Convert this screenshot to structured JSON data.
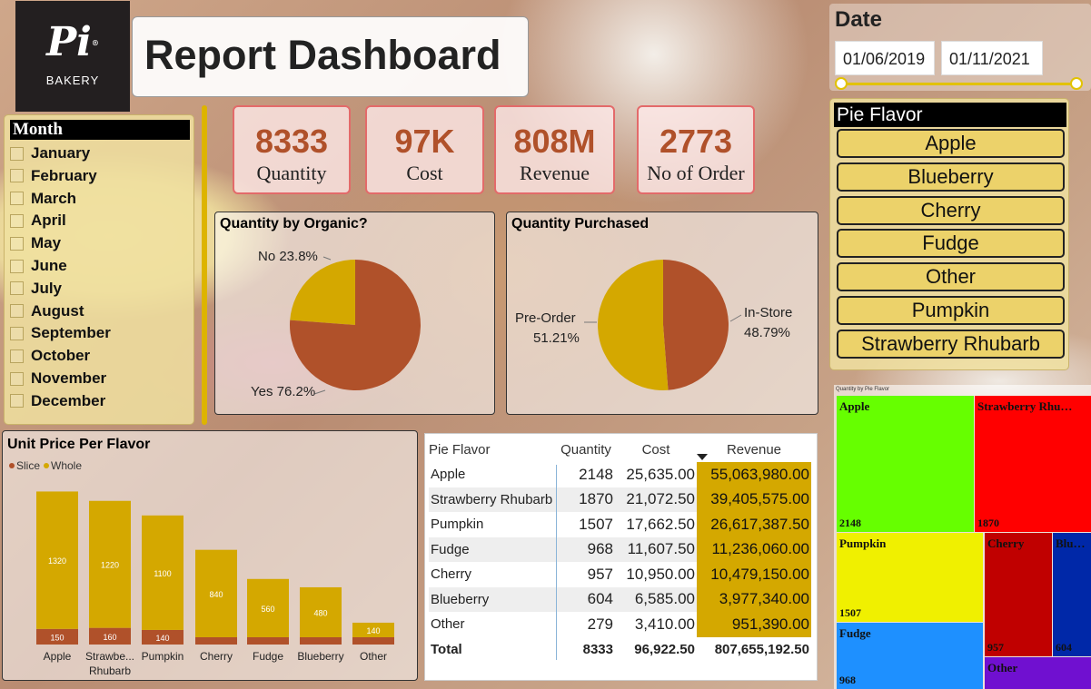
{
  "logo": {
    "mark": "Pi",
    "reg": "®",
    "sub": "BAKERY"
  },
  "title": "Report Dashboard",
  "month_slicer": {
    "title": "Month",
    "items": [
      "January",
      "February",
      "March",
      "April",
      "May",
      "June",
      "July",
      "August",
      "September",
      "October",
      "November",
      "December"
    ]
  },
  "kpis": [
    {
      "value": "8333",
      "label": "Quantity"
    },
    {
      "value": "97K",
      "label": "Cost"
    },
    {
      "value": "808M",
      "label": "Revenue"
    },
    {
      "value": "2773",
      "label": "No of Order"
    }
  ],
  "date_slicer": {
    "title": "Date",
    "start": "01/06/2019",
    "end": "01/11/2021"
  },
  "flavor_slicer": {
    "title": "Pie Flavor",
    "items": [
      "Apple",
      "Blueberry",
      "Cherry",
      "Fudge",
      "Other",
      "Pumpkin",
      "Strawberry Rhubarb"
    ]
  },
  "colors": {
    "accent": "#d4a800",
    "brand": "#b0512a",
    "kpi_border": "#e36a6a"
  },
  "chart_data": [
    {
      "type": "pie",
      "title": "Quantity by Organic?",
      "labels": [
        "No 23.8%",
        "Yes 76.2%"
      ],
      "slices": [
        {
          "name": "No",
          "value": 23.8,
          "color": "#d4a800"
        },
        {
          "name": "Yes",
          "value": 76.2,
          "color": "#b0512a"
        }
      ]
    },
    {
      "type": "pie",
      "title": "Quantity Purchased",
      "labels": {
        "left_name": "Pre-Order",
        "left_value": "51.21%",
        "right_name": "In-Store",
        "right_value": "48.79%"
      },
      "slices": [
        {
          "name": "In-Store",
          "value": 48.79,
          "color": "#b0512a"
        },
        {
          "name": "Pre-Order",
          "value": 51.21,
          "color": "#d4a800"
        }
      ]
    },
    {
      "type": "bar",
      "title": "Unit Price Per Flavor",
      "stacked": true,
      "legend": [
        "Slice",
        "Whole"
      ],
      "categories": [
        "Apple",
        "Strawbe... Rhubarb",
        "Pumpkin",
        "Cherry",
        "Fudge",
        "Blueberry",
        "Other"
      ],
      "series": [
        {
          "name": "Slice",
          "color": "#b0512a",
          "values": [
            150,
            160,
            140,
            null,
            null,
            null,
            null
          ]
        },
        {
          "name": "Whole",
          "color": "#d4a800",
          "values": [
            1320,
            1220,
            1100,
            840,
            560,
            480,
            140
          ]
        }
      ],
      "ylim": [
        0,
        1500
      ]
    },
    {
      "type": "table",
      "columns": [
        "Pie Flavor",
        "Quantity",
        "Cost",
        "Revenue"
      ],
      "rows": [
        [
          "Apple",
          "2148",
          "25,635.00",
          "55,063,980.00"
        ],
        [
          "Strawberry Rhubarb",
          "1870",
          "21,072.50",
          "39,405,575.00"
        ],
        [
          "Pumpkin",
          "1507",
          "17,662.50",
          "26,617,387.50"
        ],
        [
          "Fudge",
          "968",
          "11,607.50",
          "11,236,060.00"
        ],
        [
          "Cherry",
          "957",
          "10,950.00",
          "10,479,150.00"
        ],
        [
          "Blueberry",
          "604",
          "6,585.00",
          "3,977,340.00"
        ],
        [
          "Other",
          "279",
          "3,410.00",
          "951,390.00"
        ]
      ],
      "total": [
        "Total",
        "8333",
        "96,922.50",
        "807,655,192.50"
      ]
    },
    {
      "type": "treemap",
      "title": "Quantity by Pie Flavor",
      "cells": [
        {
          "name": "Apple",
          "value": "2148",
          "color": "#66ff00"
        },
        {
          "name": "Strawberry Rhu…",
          "value": "1870",
          "color": "#ff0000"
        },
        {
          "name": "Pumpkin",
          "value": "1507",
          "color": "#f0f000"
        },
        {
          "name": "Cherry",
          "value": "957",
          "color": "#c00000"
        },
        {
          "name": "Blu…",
          "value": "604",
          "color": "#0028a8"
        },
        {
          "name": "Fudge",
          "value": "968",
          "color": "#1e90ff"
        },
        {
          "name": "Other",
          "value": "",
          "color": "#7010d0"
        }
      ]
    }
  ]
}
